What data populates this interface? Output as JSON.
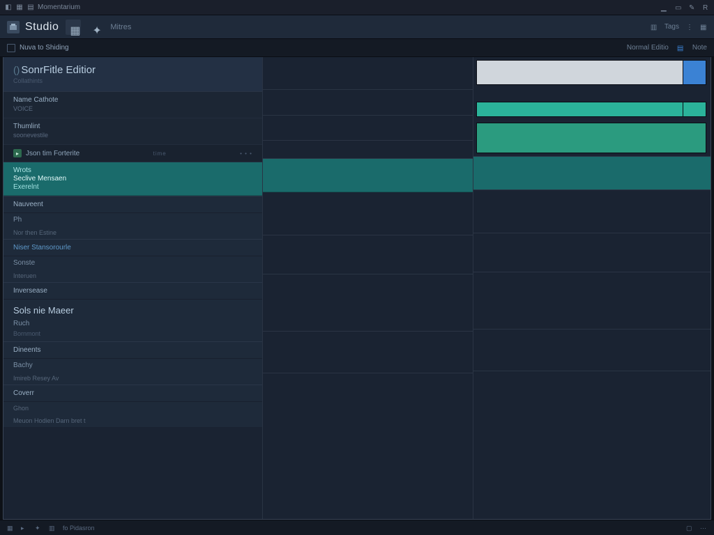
{
  "titlebar": {
    "app": "Momentarium"
  },
  "topbar": {
    "brand": "Studio",
    "menu": "Mitres",
    "right_label": "Tags"
  },
  "tabbar": {
    "tab1": "Nuva to Shiding",
    "right1": "Normal Editio",
    "right2": "Note"
  },
  "editor": {
    "title": "SonrFitle Editior",
    "subtitle": "Collathints",
    "prop1": {
      "label": "Name Cathote",
      "value": "VOICE"
    },
    "prop2": {
      "label": "Thumlint",
      "value": "soonevestile"
    },
    "runtime": "Json tim Forterite",
    "runtime_tag": "time",
    "teal": {
      "l1": "Wrots",
      "l2": "Seclive Mensaen",
      "l3": "Exerelnt"
    },
    "g1": {
      "head": "Nauveent",
      "i1": "Ph",
      "i2": "Nor then Estine"
    },
    "g2": {
      "head": "Niser Stansorourle",
      "i1": "Sonste",
      "i2": "Interuen"
    },
    "g3": {
      "head": "Inversease",
      "title": "Sols nie Maeer",
      "i1": "Ruch",
      "i2": "Bornmont"
    },
    "g4": {
      "head": "Dineents",
      "i1": "Bachy",
      "i2": "Imireb Resey Av"
    },
    "g5": {
      "head": "Coverr",
      "i1": "Ghon",
      "i2": "Meuon Hodien Darn bret t"
    }
  },
  "statusbar": {
    "label": "fo Pidasron"
  },
  "colors": {
    "teal": "#1a6b6b",
    "mint": "#2bb39a",
    "green": "#2b9b7f",
    "light": "#d0d6dc",
    "blue": "#3b82d4"
  }
}
